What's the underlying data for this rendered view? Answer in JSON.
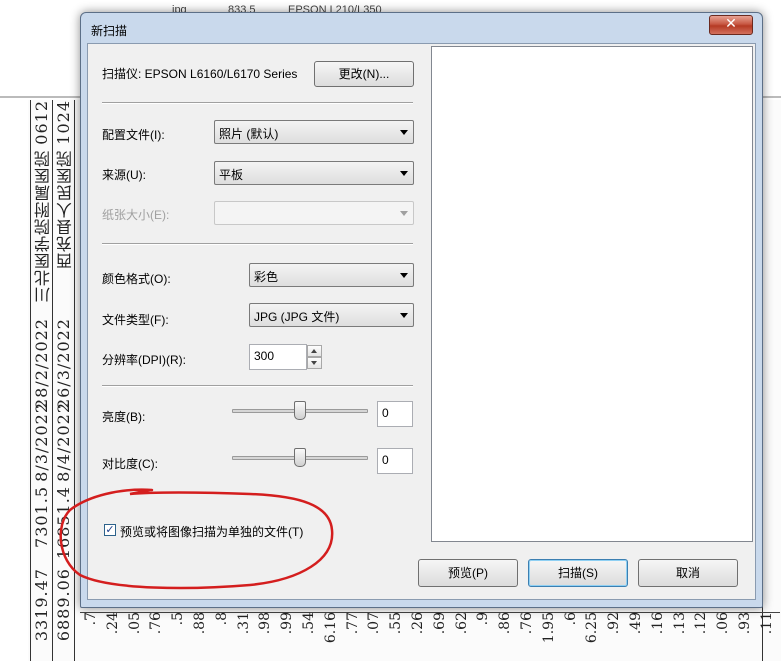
{
  "background": {
    "top_row": [
      "jpg",
      "833.5",
      "EPSON L210/L350"
    ],
    "vertical_texts": [
      "0612",
      "1024",
      "川北医学院附属医院",
      "西充县人民医院",
      "28/2/2022",
      "26/3/2022",
      "8/3/2022",
      "8/4/2022",
      "7301.5",
      "16851.4",
      "3319.47",
      "6889.06"
    ],
    "bottom_numbers": [
      ".7",
      ".24",
      ".05",
      ".76",
      ".5",
      ".88",
      ".8",
      ".31",
      ".98",
      ".99",
      ".54",
      "6.16",
      ".77",
      ".07",
      ".55",
      ".26",
      ".69",
      ".62",
      ".9",
      ".86",
      ".76",
      "1.95",
      ".6",
      "6.25",
      ".92",
      ".49",
      ".16",
      ".13",
      ".12",
      ".06",
      ".93",
      ".11"
    ]
  },
  "dialog": {
    "title": "新扫描",
    "close_glyph": "✕",
    "scanner_label": "扫描仪: EPSON L6160/L6170 Series",
    "change_button": "更改(N)...",
    "profile": {
      "label": "配置文件(I):",
      "value": "照片 (默认)"
    },
    "source": {
      "label": "来源(U):",
      "value": "平板"
    },
    "paper_size": {
      "label": "纸张大小(E):",
      "value": ""
    },
    "color_format": {
      "label": "颜色格式(O):",
      "value": "彩色"
    },
    "file_type": {
      "label": "文件类型(F):",
      "value": "JPG (JPG 文件)"
    },
    "resolution": {
      "label": "分辨率(DPI)(R):",
      "value": "300"
    },
    "brightness": {
      "label": "亮度(B):",
      "value": "0",
      "level": 0.5
    },
    "contrast": {
      "label": "对比度(C):",
      "value": "0",
      "level": 0.5
    },
    "separate_files": {
      "label": "预览或将图像扫描为单独的文件(T)",
      "checked": true,
      "check_glyph": "✓"
    },
    "buttons": {
      "preview": "预览(P)",
      "scan": "扫描(S)",
      "cancel": "取消"
    }
  },
  "colors": {
    "annotation": "#d41e1e",
    "title_bar": "#c9d9ec",
    "close_button": "#c75843"
  }
}
